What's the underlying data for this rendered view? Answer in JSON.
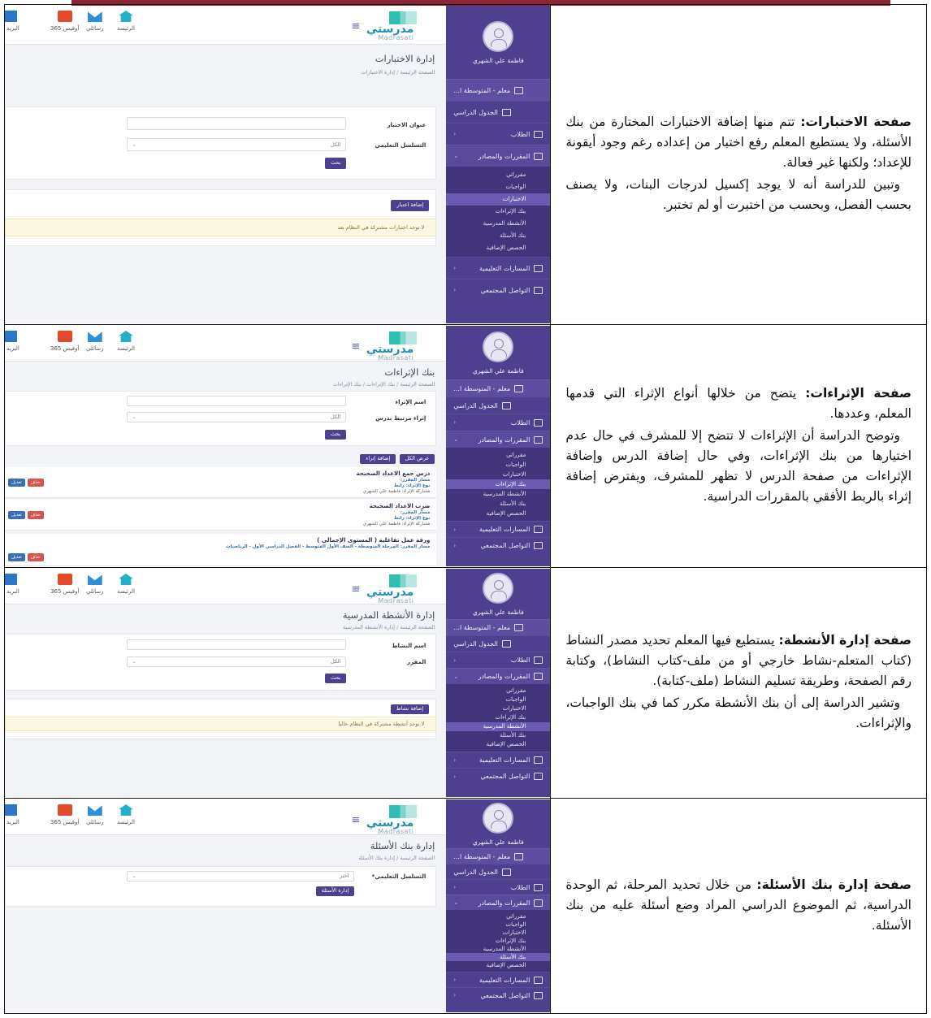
{
  "app": {
    "logo_ar": "مدرستي",
    "logo_en": "Madrasati",
    "user_name": "فاطمة علي الشهري",
    "header_nav": [
      "الرئيسة",
      "رسائلي",
      "أوفيس 365",
      "البريد الإ"
    ],
    "role_item": "معلم - المتوسطة ا...",
    "sidebar_items": [
      "الجدول الدراسي",
      "الطلاب",
      "المقررات والمصادر"
    ],
    "sidebar_sub": [
      "مقرراتي",
      "الواجبات",
      "الاختبارات",
      "بنك الإثراءات",
      "الأنشطة المدرسية",
      "بنك الأسئلة",
      "الحصص الإضافية"
    ],
    "sidebar_bottom": [
      "المسارات التعليمية",
      "التواصل المجتمعي"
    ],
    "home_crumb": "الصفحة الرئيسة"
  },
  "rows": [
    {
      "page_title": "إدارة الاختبارات",
      "crumb_current": "إدارة الاختبارات",
      "field1_label": "عنوان الاختبار",
      "field2_label": "التسلسل التعليمي",
      "field2_value": "الكل",
      "search_btn": "بحث",
      "add_btn": "إضافة اختبار",
      "empty_msg": "لا توجد اختبارات مشتركة في النظام بعد",
      "text_title": "صفحة الاختبارات:",
      "text_p1": " تتم منها إضافة الاختبارات المختارة من بنك الأسئلة، ولا يستطيع المعلم رفع اختبار من إعداده رغم وجود أيقونة للإعداد؛ ولكنها غير فعالة.",
      "text_p2": "وتبين للدراسة أنه لا يوجد إكسيل لدرجات البنات، ولا يصنف بحسب الفصل، وبحسب من اختبرت أو لم تختبر."
    },
    {
      "page_title": "بنك الإثراءات",
      "crumb_parent": "بنك الإثراءات",
      "crumb_current": "بنك الإثراءات",
      "field1_label": "اسم الإثراء",
      "field2_label": "إثراء مرتبط بدرس",
      "field2_value": "الكل",
      "search_btn": "بحث",
      "show_all_btn": "عرض الكل",
      "add_btn": "إضافة إثراء",
      "edit_btn": "تعديل",
      "delete_btn": "حذف",
      "cards": [
        {
          "title": "درس جمع الاعداد الصحيحة",
          "path": "مسار المقرر:",
          "type": "نوع الإثراء: رابط",
          "share": "مشاركة الإثراء: فاطمة علي الشهري"
        },
        {
          "title": "ضرب الاعداد الصحيحة",
          "path": "مسار المقرر:",
          "type": "نوع الإثراء: رابط",
          "share": "مشاركة الإثراء: فاطمة علي الشهري"
        },
        {
          "title": "ورقة عمل تفاعلية ( المستوى الإجمالي )",
          "path": "مسار المقرر: المرحلة المتوسطة - الصف الأول المتوسط - الفصل الدراسي الأول - الرياضيات",
          "type": "",
          "share": ""
        }
      ],
      "text_title": "صفحة الإثراءات:",
      "text_p1": " يتضح من خلالها أنواع الإثراء التي قدمها المعلم، وعددها.",
      "text_p2": "وتوضح الدراسة أن الإثراءات لا تتضح إلا للمشرف في حال عدم اختيارها من بنك الإثراءات، وفي حال إضافة الدرس وإضافة الإثراءات من صفحة الدرس لا تظهر للمشرف، ويفترض إضافة إثراء بالربط الأفقي بالمقررات الدراسية."
    },
    {
      "page_title": "إدارة الأنشطة المدرسية",
      "crumb_current": "إدارة الأنشطة المدرسية",
      "field1_label": "اسم النشاط",
      "field2_label": "المقرر",
      "field2_value": "الكل",
      "search_btn": "بحث",
      "add_btn": "إضافة نشاط",
      "empty_msg": "لا توجد أنشطة مشتركة في النظام حاليا",
      "text_title": "صفحة إدارة الأنشطة:",
      "text_p1": " يستطيع فيها المعلم تحديد مصدر النشاط (كتاب المتعلم-نشاط خارجي أو من ملف-كتاب النشاط)، وكتابة رقم الصفحة، وطريقة تسليم النشاط (ملف-كتابة).",
      "text_p2": "وتشير الدراسة إلى أن بنك الأنشطة مكرر كما في بنك الواجبات، والإثراءات."
    },
    {
      "page_title": "إدارة بنك الأسئلة",
      "crumb_current": "إدارة بنك الأسئلة",
      "field2_label": "التسلسل التعليمي*",
      "field2_value": "اختر",
      "manage_btn": "إدارة الأسئلة",
      "text_title": "صفحة إدارة بنك الأسئلة:",
      "text_p1": " من خلال تحديد المرحلة، ثم الوحدة الدراسية، ثم الموضوع الدراسي المراد وضع أسئلة عليه من بنك الأسئلة."
    }
  ],
  "colors": {
    "sidebar": "#4e3f8f",
    "accent_bar": "#8c2433",
    "active_sub": "#6a5bb0"
  }
}
